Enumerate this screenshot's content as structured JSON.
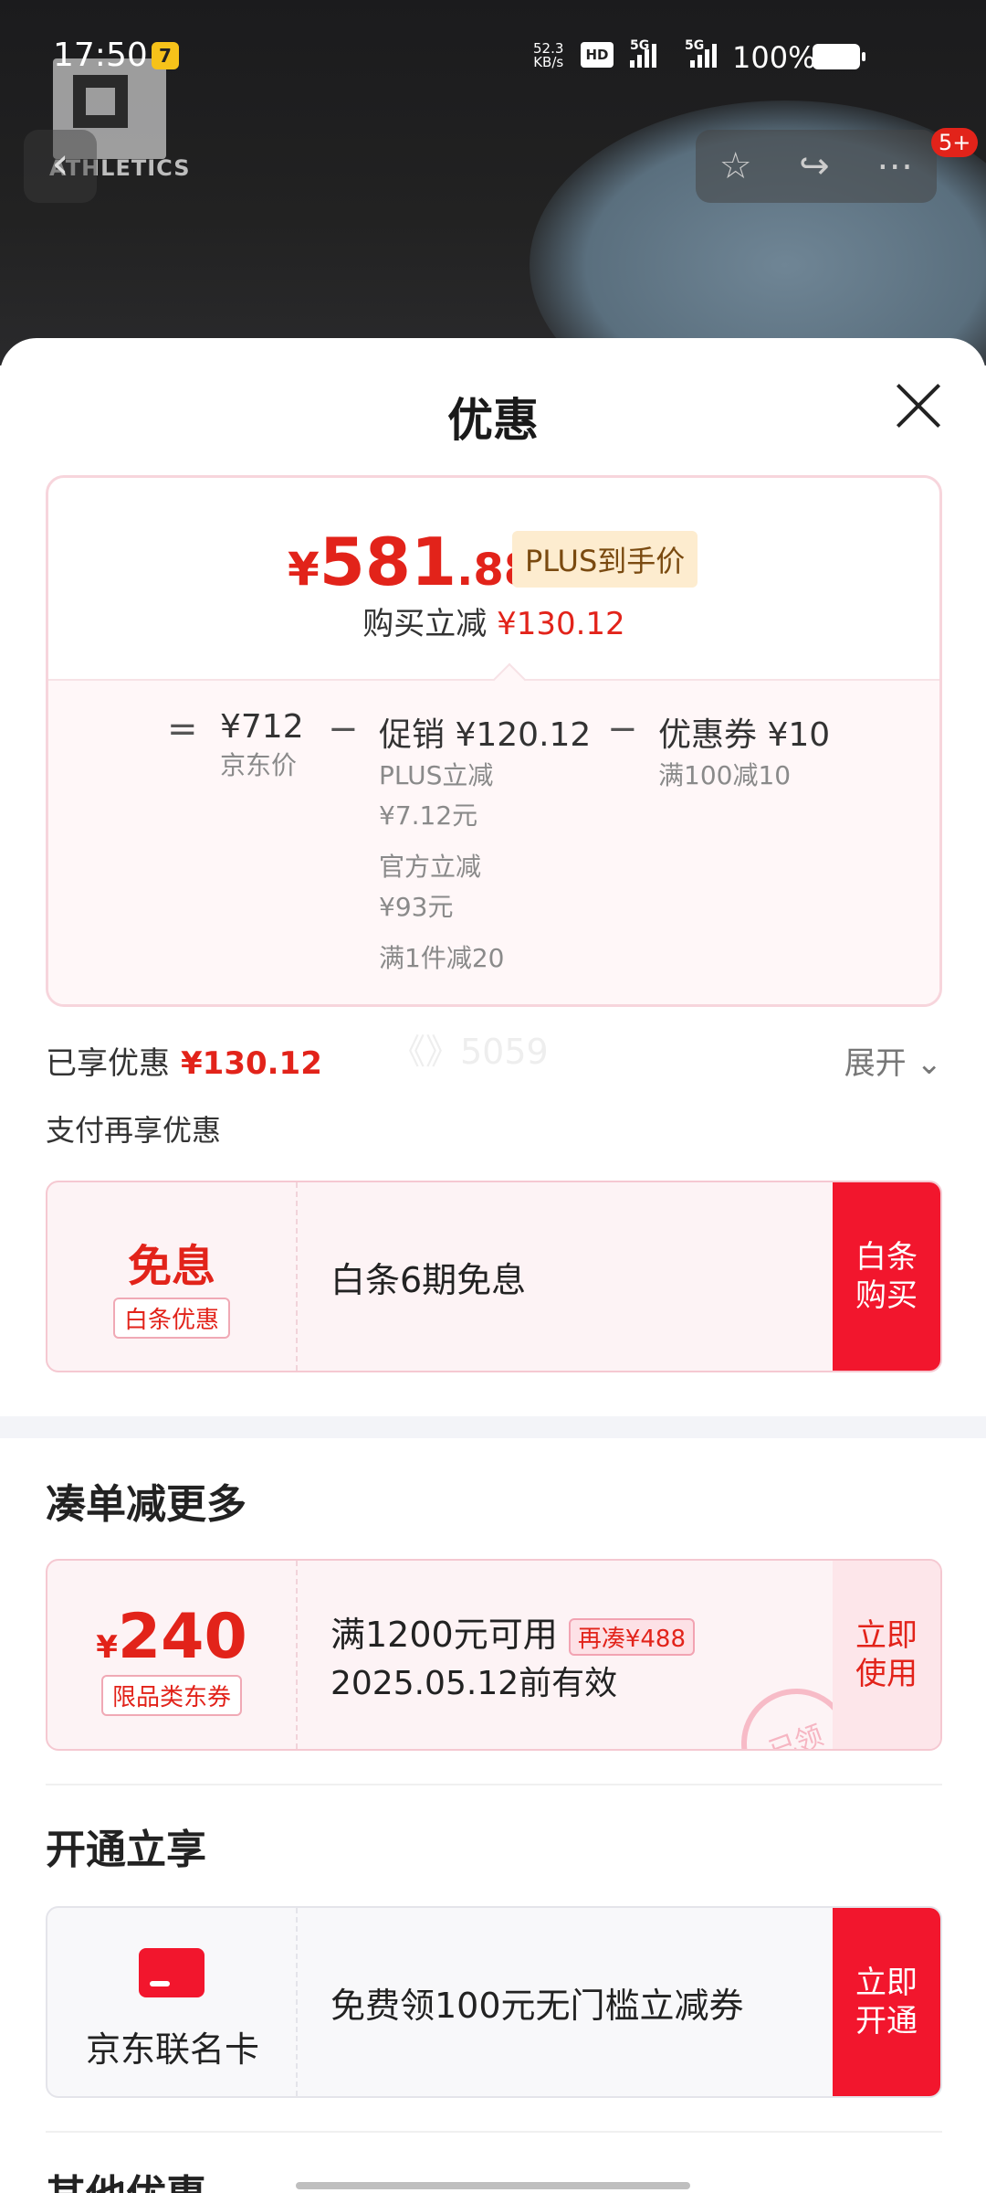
{
  "status_bar": {
    "time": "17:50",
    "net_speed_value": "52.3",
    "net_speed_unit": "KB/s",
    "hd_label": "HD",
    "sig1_label": "5G",
    "sig2_label": "5G",
    "battery": "100%"
  },
  "hero": {
    "logo_text": "ATHLETICS",
    "back_icon": "chevron-left-icon",
    "badge": "5+"
  },
  "sheet": {
    "title": "优惠"
  },
  "price": {
    "yen": "¥",
    "integer": "581",
    "decimal": ".88",
    "plus_tag": "PLUS到手价",
    "instant_label": "购买立减",
    "instant_value": "¥130.12"
  },
  "breakdown": {
    "equals": "=",
    "jd_price": "¥712",
    "jd_price_label": "京东价",
    "minus": "−",
    "promo_label": "促销",
    "promo_value": "¥120.12",
    "promo_items": [
      "PLUS立减",
      "¥7.12元",
      "官方立减",
      "¥93元",
      "满1件减20"
    ],
    "coupon_label": "优惠券",
    "coupon_value": "¥10",
    "coupon_note": "满100减10"
  },
  "saved": {
    "label": "已享优惠",
    "value": "¥130.12",
    "expand": "展开"
  },
  "watermark": "《》5059",
  "pay_more": "支付再享优惠",
  "baitiao": {
    "title": "免息",
    "tag": "白条优惠",
    "desc": "白条6期免息",
    "button": "白条\n购买"
  },
  "combine": {
    "section_title": "凑单减更多",
    "yen": "¥",
    "amount": "240",
    "tag": "限品类东券",
    "condition": "满1200元可用",
    "extra_tag": "再凑¥488",
    "expiry": "2025.05.12前有效",
    "button": "立即\n使用",
    "stamp": "已领"
  },
  "open": {
    "section_title": "开通立享",
    "card_name": "京东联名卡",
    "desc": "免费领100元无门槛立减券",
    "button": "立即\n开通"
  },
  "other": {
    "section_title": "其他优惠"
  },
  "colors": {
    "accent_red": "#e2231a",
    "button_red": "#f2162d",
    "plus_tag_bg": "#fdeccf"
  }
}
